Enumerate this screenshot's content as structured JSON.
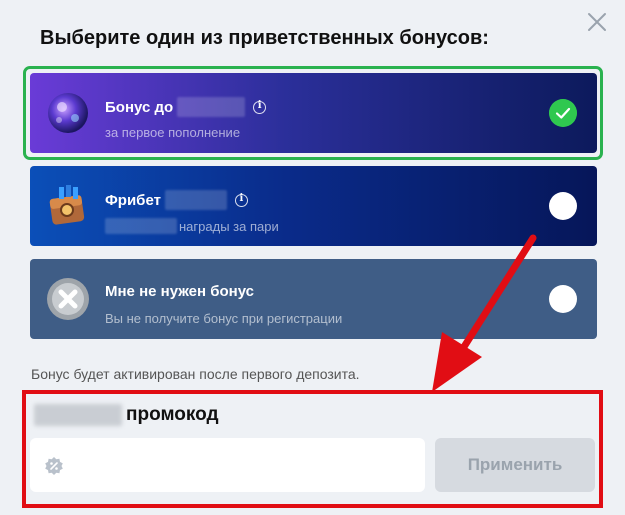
{
  "dialog": {
    "title": "Выберите один из приветственных бонусов:",
    "note": "Бонус будет активирован после первого депозита."
  },
  "bonuses": [
    {
      "name": "Бонус до",
      "subtitle": "за первое пополнение",
      "selected": true,
      "icon": "planet-icon"
    },
    {
      "name": "Фрибет",
      "subtitle": "награды за пари",
      "selected": false,
      "icon": "treasure-chest-icon"
    },
    {
      "name": "Мне не нужен бонус",
      "subtitle": "Вы не получите бонус при регистрации",
      "selected": false,
      "icon": "cross-circle-icon"
    }
  ],
  "promo": {
    "label": "промокод",
    "placeholder": "",
    "value": "",
    "apply_label": "Применить"
  },
  "colors": {
    "selected_border": "#2ab24f",
    "check_green": "#2fc84f",
    "highlight_red": "#e10d14",
    "card_dark": "#0a1e6c",
    "card_grey": "#3f5d86"
  }
}
